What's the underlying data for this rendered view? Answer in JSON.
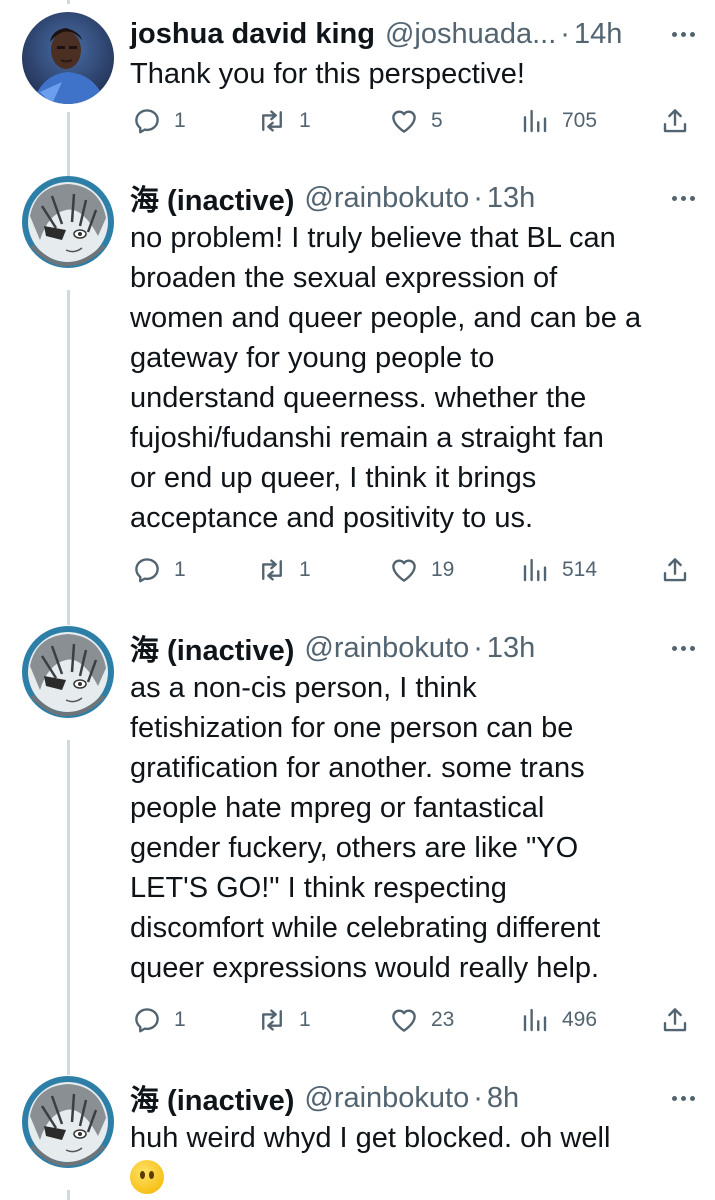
{
  "tweets": [
    {
      "name": "joshua david king",
      "handle": "@joshuada...",
      "time": "14h",
      "text": "Thank you for this perspective!",
      "replies": "1",
      "retweets": "1",
      "likes": "5",
      "views": "705"
    },
    {
      "name": "海 (inactive)",
      "handle": "@rainbokuto",
      "time": "13h",
      "text": "no problem! I truly believe that BL can\nbroaden the sexual expression of\nwomen and queer people, and can be a\ngateway for young people to\nunderstand queerness. whether the\nfujoshi/fudanshi remain a straight fan\nor end up queer, I think it brings\nacceptance and positivity to us.",
      "replies": "1",
      "retweets": "1",
      "likes": "19",
      "views": "514"
    },
    {
      "name": "海 (inactive)",
      "handle": "@rainbokuto",
      "time": "13h",
      "text": "as a non-cis person, I think\nfetishization for one person can be\ngratification for another. some trans\npeople hate mpreg or fantastical\ngender fuckery, others are like \"YO\nLET'S GO!\" I think respecting\ndiscomfort while celebrating different\nqueer expressions would really help.",
      "replies": "1",
      "retweets": "1",
      "likes": "23",
      "views": "496"
    },
    {
      "name": "海 (inactive)",
      "handle": "@rainbokuto",
      "time": "8h",
      "text": "huh weird whyd I get blocked. oh well",
      "emoji_icon": "face-without-mouth-emoji"
    }
  ],
  "icons": {
    "reply": "reply-icon",
    "retweet": "retweet-icon",
    "like": "heart-icon",
    "views": "views-icon",
    "share": "share-icon",
    "more": "more-icon"
  },
  "colors": {
    "text": "#0f1419",
    "secondary": "#536471",
    "thread_line": "#cfd9de"
  }
}
